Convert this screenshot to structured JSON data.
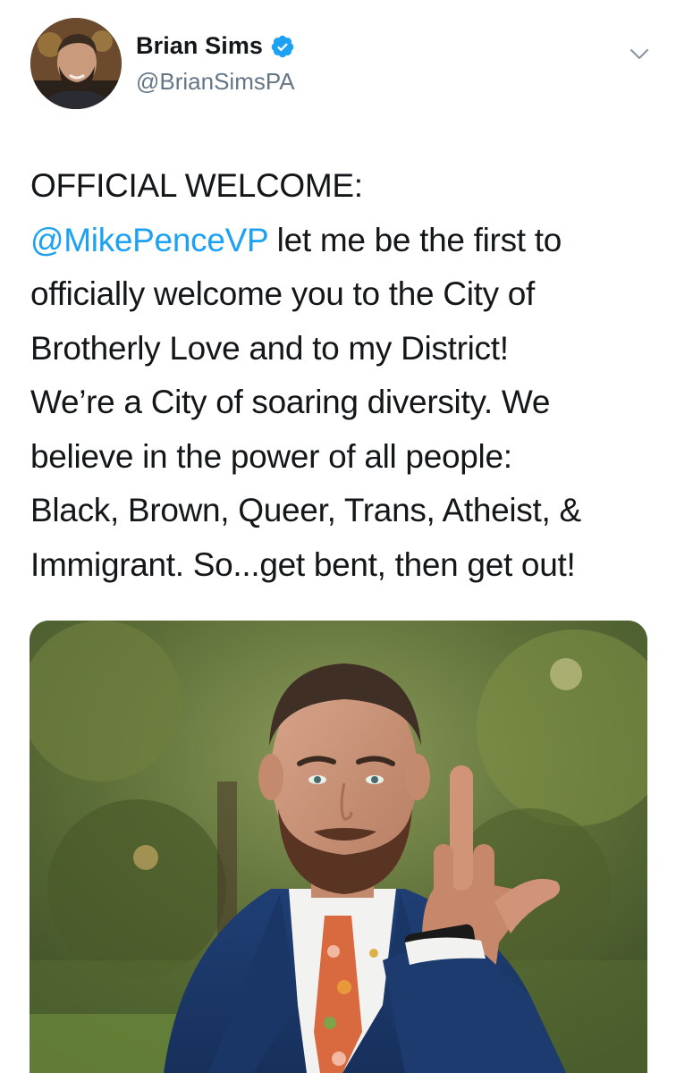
{
  "author": {
    "display_name": "Brian Sims",
    "handle": "@BrianSimsPA",
    "verified": true,
    "verified_icon": "verified-badge-icon",
    "avatar": "profile-photo"
  },
  "menu": {
    "icon": "chevron-down-icon"
  },
  "tweet": {
    "lines": [
      {
        "text": "OFFICIAL WELCOME:"
      },
      {
        "mention": "@MikePenceVP",
        "text": " let me be the first to"
      },
      {
        "text": "officially welcome you to the City of"
      },
      {
        "text": "Brotherly Love and to my District!"
      },
      {
        "text": "We’re a City of soaring diversity. We"
      },
      {
        "text": "believe in the power of all people:"
      },
      {
        "text": "Black, Brown, Queer, Trans, Atheist, &"
      },
      {
        "text": "Immigrant. So...get bent, then get out!"
      }
    ]
  },
  "media": {
    "type": "photo"
  },
  "colors": {
    "text": "#14171a",
    "secondary": "#657786",
    "accent": "#1da1f2"
  }
}
